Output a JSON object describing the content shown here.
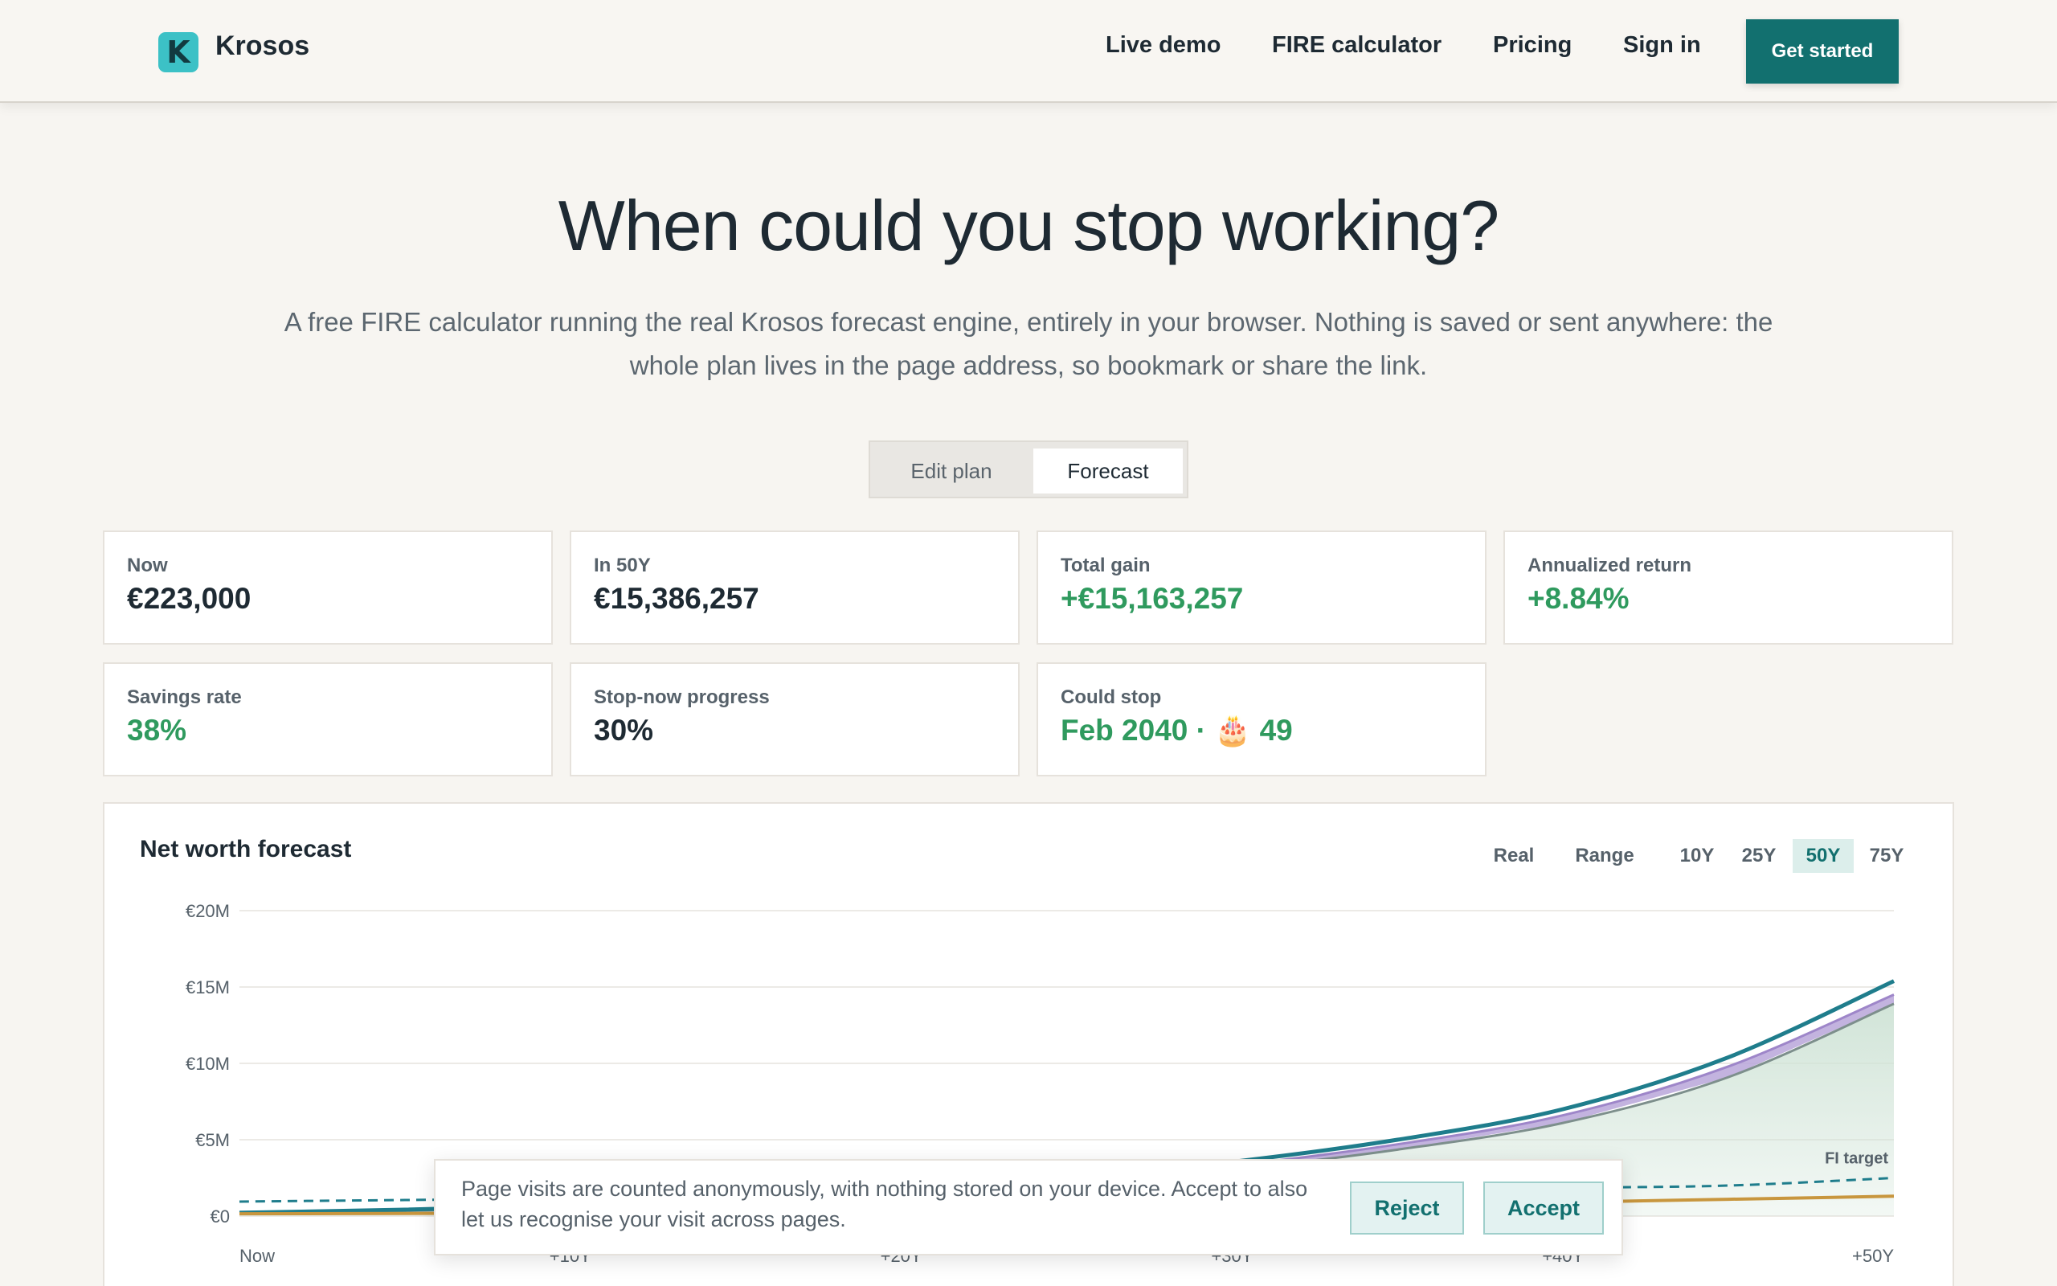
{
  "header": {
    "logo_letter": "K",
    "brand": "Krosos",
    "nav": [
      "Live demo",
      "FIRE calculator",
      "Pricing",
      "Sign in"
    ],
    "cta": "Get started"
  },
  "hero": {
    "title": "When could you stop working?",
    "subtitle": "A free FIRE calculator running the real Krosos forecast engine, entirely in your browser. Nothing is saved or sent anywhere: the whole plan lives in the page address, so bookmark or share the link."
  },
  "toggle": {
    "edit": "Edit plan",
    "forecast": "Forecast",
    "active": "Forecast"
  },
  "stats": [
    {
      "label": "Now",
      "value": "€223,000",
      "color": "dark"
    },
    {
      "label": "In 50Y",
      "value": "€15,386,257",
      "color": "dark"
    },
    {
      "label": "Total gain",
      "value": "+€15,163,257",
      "color": "green"
    },
    {
      "label": "Annualized return",
      "value": "+8.84%",
      "color": "green"
    },
    {
      "label": "Savings rate",
      "value": "38%",
      "color": "green"
    },
    {
      "label": "Stop-now progress",
      "value": "30%",
      "color": "dark"
    },
    {
      "label": "Could stop",
      "value": "Feb 2040 · 🎂 49",
      "color": "green"
    }
  ],
  "chart_panel": {
    "title": "Net worth forecast",
    "controls": [
      "Real",
      "Range"
    ],
    "ranges": [
      "10Y",
      "25Y",
      "50Y",
      "75Y"
    ],
    "active_range": "50Y"
  },
  "chart_data": {
    "type": "area",
    "title": "Net worth forecast",
    "y_tick_labels": [
      "€0",
      "€5M",
      "€10M",
      "€15M",
      "€20M"
    ],
    "x_tick_labels": [
      "Now",
      "+10Y",
      "+20Y",
      "+30Y",
      "+40Y",
      "+50Y"
    ],
    "ylim": [
      0,
      20
    ],
    "y_unit": "€M",
    "x_years": [
      0,
      5,
      10,
      15,
      20,
      25,
      30,
      35,
      40,
      45,
      50
    ],
    "series": [
      {
        "values": [
          0.22,
          0.42,
          0.7,
          1.1,
          1.7,
          2.5,
          3.55,
          5.0,
          7.0,
          10.4,
          15.39
        ]
      },
      {
        "values": [
          0.2,
          0.38,
          0.64,
          1.0,
          1.55,
          2.3,
          3.3,
          4.7,
          6.6,
          9.8,
          14.5
        ]
      },
      {
        "values": [
          0.18,
          0.34,
          0.58,
          0.92,
          1.42,
          2.1,
          3.05,
          4.35,
          6.1,
          9.1,
          13.9
        ]
      },
      {
        "values": [
          0.15,
          0.17,
          0.2,
          0.25,
          0.32,
          0.42,
          0.55,
          0.72,
          0.9,
          1.1,
          1.3
        ]
      }
    ],
    "fi_target": {
      "label": "FI target",
      "values": [
        0.95,
        1.05,
        1.15,
        1.25,
        1.35,
        1.45,
        1.55,
        1.7,
        1.85,
        2.0,
        2.5
      ]
    },
    "grid": true,
    "colors": {
      "teal": "#1f7d8c",
      "purple": "#b9a6d9",
      "gray": "#7d8f8c",
      "orange": "#c8963e",
      "fill": "#cfe3d6"
    }
  },
  "cookie": {
    "text": "Page visits are counted anonymously, with nothing stored on your device. Accept to also let us recognise your visit across pages.",
    "reject": "Reject",
    "accept": "Accept"
  }
}
